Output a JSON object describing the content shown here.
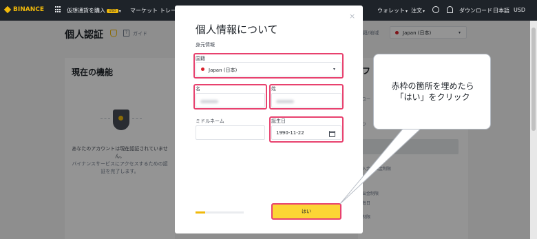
{
  "nav": {
    "logo": "BINANCE",
    "buy_crypto": "仮想通貨を購入",
    "buy_badge": "USD",
    "markets": "マーケット",
    "trade": "トレー",
    "wallet": "ウォレット",
    "orders": "注文",
    "download": "ダウンロード",
    "language": "日本語",
    "currency": "USD"
  },
  "page": {
    "title": "個人認証",
    "guide": "ガイド",
    "current_features": "現在の機能",
    "status_text": "あなたのアカウントは現在認証されていません。",
    "status_desc": "バイナンスサービスにアクセスするための認証を完了します。",
    "region_label": "国籍/地域",
    "region_value": "Japan (日本)",
    "right_heading": "フ",
    "right_lines": [
      "ユー",
      "フ",
      "入金＆出金制限",
      "日",
      "出金制限",
      "毎日",
      "制限"
    ]
  },
  "modal": {
    "close": "×",
    "title": "個人情報について",
    "section": "身元情報",
    "nationality_label": "国籍",
    "nationality_value": "Japan (日本)",
    "first_name_label": "名",
    "last_name_label": "姓",
    "middle_name_label": "ミドルネーム",
    "dob_label": "誕生日",
    "dob_value": "1990-11-22",
    "yes_button": "はい",
    "progress": 0.2
  },
  "callout": {
    "line1": "赤枠の箇所を埋めたら",
    "line2": "「はい」をクリック"
  },
  "colors": {
    "highlight": "#e8416e",
    "brand": "#f0b90b",
    "nav_bg": "#1e2329"
  }
}
